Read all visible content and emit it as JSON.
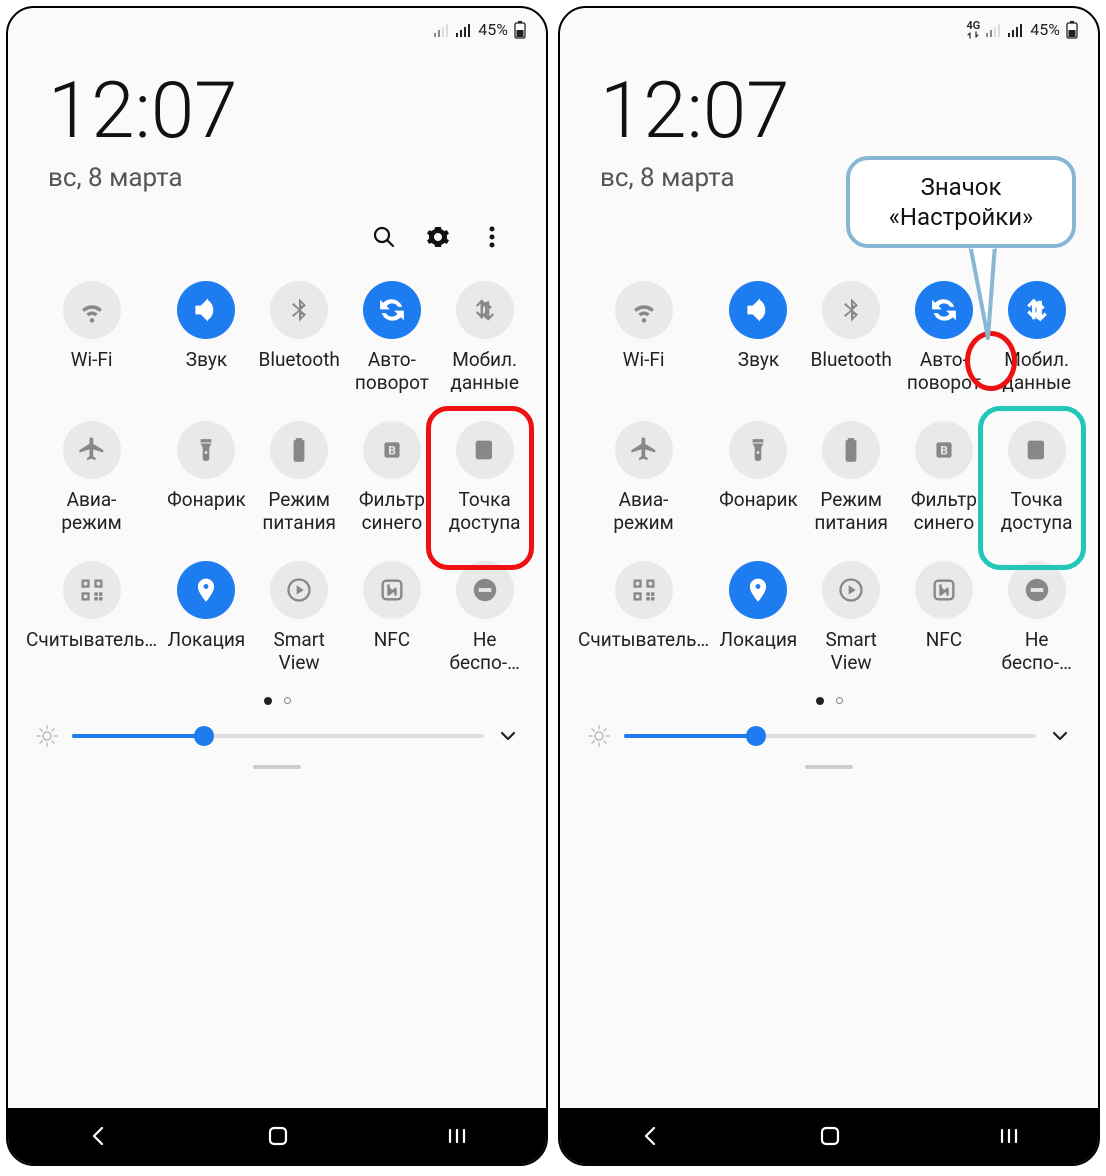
{
  "status": {
    "battery": "45%",
    "fourg": "4G"
  },
  "clock": {
    "time": "12:07",
    "date": "вс, 8 марта"
  },
  "tiles": [
    {
      "id": "wifi",
      "label": "Wi-Fi",
      "on1": false,
      "on2": false
    },
    {
      "id": "sound",
      "label": "Звук",
      "on1": true,
      "on2": true
    },
    {
      "id": "bluetooth",
      "label": "Bluetooth",
      "on1": false,
      "on2": false
    },
    {
      "id": "autorotate",
      "label": "Авто-\nповорот",
      "on1": true,
      "on2": true
    },
    {
      "id": "mobiledata",
      "label": "Мобил.\nданные",
      "on1": false,
      "on2": true
    },
    {
      "id": "airplane",
      "label": "Авиа-\nрежим",
      "on1": false,
      "on2": false
    },
    {
      "id": "flashlight",
      "label": "Фонарик",
      "on1": false,
      "on2": false
    },
    {
      "id": "powermode",
      "label": "Режим\nпитания",
      "on1": false,
      "on2": false
    },
    {
      "id": "bluefilter",
      "label": "Фильтр\nсинего",
      "on1": false,
      "on2": false
    },
    {
      "id": "hotspot",
      "label": "Точка\nдоступа",
      "on1": false,
      "on2": false
    },
    {
      "id": "qrscan",
      "label": "Считыватель…",
      "on1": false,
      "on2": false
    },
    {
      "id": "location",
      "label": "Локация",
      "on1": true,
      "on2": true
    },
    {
      "id": "smartview",
      "label": "Smart\nView",
      "on1": false,
      "on2": false
    },
    {
      "id": "nfc",
      "label": "NFC",
      "on1": false,
      "on2": false
    },
    {
      "id": "dnd",
      "label": "Не\nбеспо-…",
      "on1": false,
      "on2": false
    }
  ],
  "brightness": {
    "percent": 32
  },
  "callout": {
    "line1": "Значок",
    "line2": "«Настройки»"
  },
  "colors": {
    "accent": "#1e7cf1",
    "red": "#e11",
    "teal": "#24c7b7",
    "bubble": "#88b7d6"
  }
}
